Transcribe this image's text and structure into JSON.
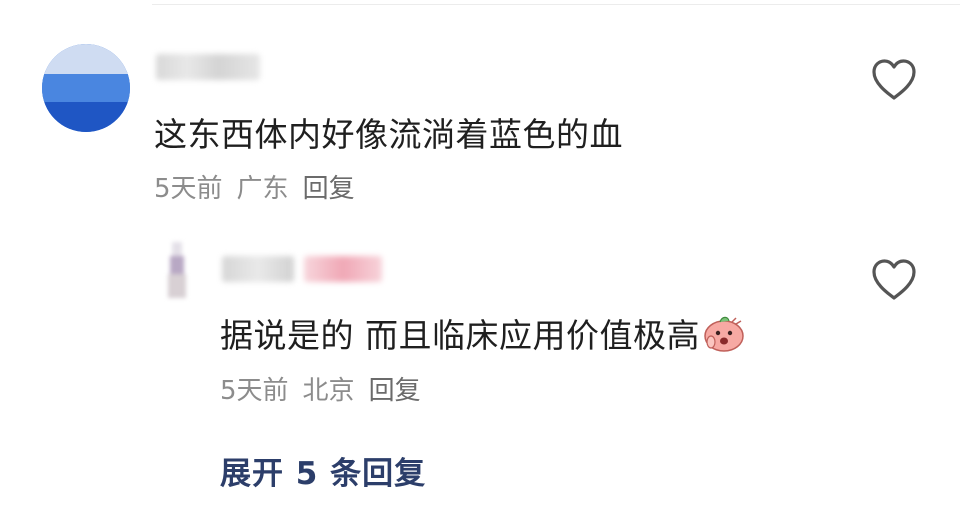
{
  "comment": {
    "text": "这东西体内好像流淌着蓝色的血",
    "time": "5天前",
    "location": "广东",
    "reply_label": "回复",
    "like_icon": "heart-outline-icon"
  },
  "reply": {
    "text": "据说是的 而且临床应用价值极高",
    "emoji": "shocked-face-emoji",
    "time": "5天前",
    "location": "北京",
    "reply_label": "回复",
    "like_icon": "heart-outline-icon"
  },
  "expand_replies": {
    "label": "展开 5 条回复"
  },
  "colors": {
    "text": "#1f1f1f",
    "meta": "#8c8c8c",
    "link": "#2c3e6a",
    "heart": "#555555"
  }
}
